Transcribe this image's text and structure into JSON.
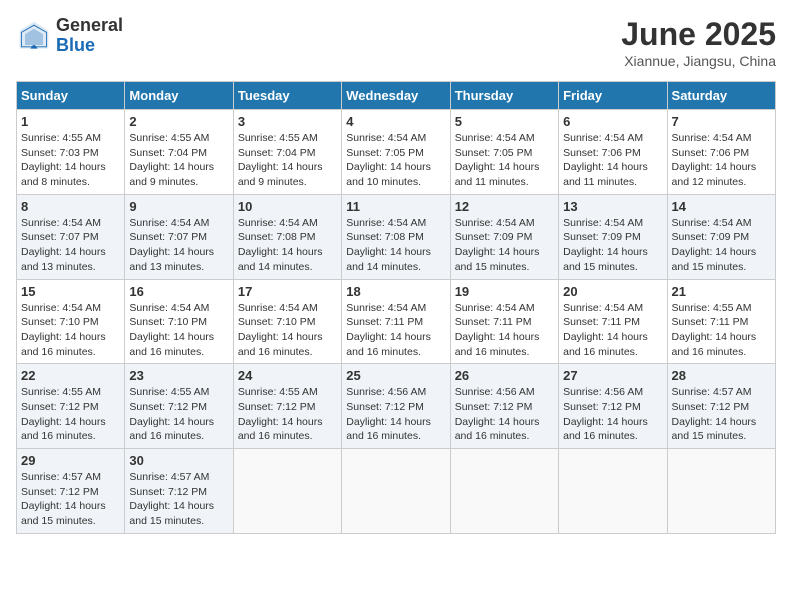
{
  "logo": {
    "general": "General",
    "blue": "Blue"
  },
  "title": "June 2025",
  "location": "Xiannue, Jiangsu, China",
  "days_of_week": [
    "Sunday",
    "Monday",
    "Tuesday",
    "Wednesday",
    "Thursday",
    "Friday",
    "Saturday"
  ],
  "weeks": [
    [
      {
        "day": 1,
        "sunrise": "4:55 AM",
        "sunset": "7:03 PM",
        "daylight": "14 hours and 8 minutes."
      },
      {
        "day": 2,
        "sunrise": "4:55 AM",
        "sunset": "7:04 PM",
        "daylight": "14 hours and 9 minutes."
      },
      {
        "day": 3,
        "sunrise": "4:55 AM",
        "sunset": "7:04 PM",
        "daylight": "14 hours and 9 minutes."
      },
      {
        "day": 4,
        "sunrise": "4:54 AM",
        "sunset": "7:05 PM",
        "daylight": "14 hours and 10 minutes."
      },
      {
        "day": 5,
        "sunrise": "4:54 AM",
        "sunset": "7:05 PM",
        "daylight": "14 hours and 11 minutes."
      },
      {
        "day": 6,
        "sunrise": "4:54 AM",
        "sunset": "7:06 PM",
        "daylight": "14 hours and 11 minutes."
      },
      {
        "day": 7,
        "sunrise": "4:54 AM",
        "sunset": "7:06 PM",
        "daylight": "14 hours and 12 minutes."
      }
    ],
    [
      {
        "day": 8,
        "sunrise": "4:54 AM",
        "sunset": "7:07 PM",
        "daylight": "14 hours and 13 minutes."
      },
      {
        "day": 9,
        "sunrise": "4:54 AM",
        "sunset": "7:07 PM",
        "daylight": "14 hours and 13 minutes."
      },
      {
        "day": 10,
        "sunrise": "4:54 AM",
        "sunset": "7:08 PM",
        "daylight": "14 hours and 14 minutes."
      },
      {
        "day": 11,
        "sunrise": "4:54 AM",
        "sunset": "7:08 PM",
        "daylight": "14 hours and 14 minutes."
      },
      {
        "day": 12,
        "sunrise": "4:54 AM",
        "sunset": "7:09 PM",
        "daylight": "14 hours and 15 minutes."
      },
      {
        "day": 13,
        "sunrise": "4:54 AM",
        "sunset": "7:09 PM",
        "daylight": "14 hours and 15 minutes."
      },
      {
        "day": 14,
        "sunrise": "4:54 AM",
        "sunset": "7:09 PM",
        "daylight": "14 hours and 15 minutes."
      }
    ],
    [
      {
        "day": 15,
        "sunrise": "4:54 AM",
        "sunset": "7:10 PM",
        "daylight": "14 hours and 16 minutes."
      },
      {
        "day": 16,
        "sunrise": "4:54 AM",
        "sunset": "7:10 PM",
        "daylight": "14 hours and 16 minutes."
      },
      {
        "day": 17,
        "sunrise": "4:54 AM",
        "sunset": "7:10 PM",
        "daylight": "14 hours and 16 minutes."
      },
      {
        "day": 18,
        "sunrise": "4:54 AM",
        "sunset": "7:11 PM",
        "daylight": "14 hours and 16 minutes."
      },
      {
        "day": 19,
        "sunrise": "4:54 AM",
        "sunset": "7:11 PM",
        "daylight": "14 hours and 16 minutes."
      },
      {
        "day": 20,
        "sunrise": "4:54 AM",
        "sunset": "7:11 PM",
        "daylight": "14 hours and 16 minutes."
      },
      {
        "day": 21,
        "sunrise": "4:55 AM",
        "sunset": "7:11 PM",
        "daylight": "14 hours and 16 minutes."
      }
    ],
    [
      {
        "day": 22,
        "sunrise": "4:55 AM",
        "sunset": "7:12 PM",
        "daylight": "14 hours and 16 minutes."
      },
      {
        "day": 23,
        "sunrise": "4:55 AM",
        "sunset": "7:12 PM",
        "daylight": "14 hours and 16 minutes."
      },
      {
        "day": 24,
        "sunrise": "4:55 AM",
        "sunset": "7:12 PM",
        "daylight": "14 hours and 16 minutes."
      },
      {
        "day": 25,
        "sunrise": "4:56 AM",
        "sunset": "7:12 PM",
        "daylight": "14 hours and 16 minutes."
      },
      {
        "day": 26,
        "sunrise": "4:56 AM",
        "sunset": "7:12 PM",
        "daylight": "14 hours and 16 minutes."
      },
      {
        "day": 27,
        "sunrise": "4:56 AM",
        "sunset": "7:12 PM",
        "daylight": "14 hours and 16 minutes."
      },
      {
        "day": 28,
        "sunrise": "4:57 AM",
        "sunset": "7:12 PM",
        "daylight": "14 hours and 15 minutes."
      }
    ],
    [
      {
        "day": 29,
        "sunrise": "4:57 AM",
        "sunset": "7:12 PM",
        "daylight": "14 hours and 15 minutes."
      },
      {
        "day": 30,
        "sunrise": "4:57 AM",
        "sunset": "7:12 PM",
        "daylight": "14 hours and 15 minutes."
      },
      null,
      null,
      null,
      null,
      null
    ]
  ]
}
